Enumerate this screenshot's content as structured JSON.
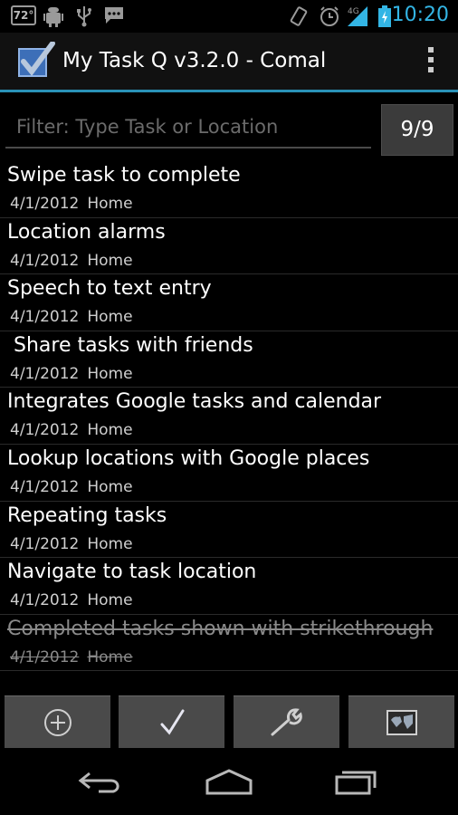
{
  "status_bar": {
    "temperature": "72°",
    "time": "10:20",
    "network": "4G",
    "icons": [
      "weather-icon",
      "android-icon",
      "usb-icon",
      "chat-icon",
      "vibrate-icon",
      "alarm-icon",
      "signal-icon",
      "battery-charging-icon"
    ]
  },
  "action_bar": {
    "title": "My Task Q v3.2.0 - Comal",
    "app_icon": "checkbox-check-icon",
    "overflow_icon": "overflow-menu-icon"
  },
  "filter": {
    "placeholder": "Filter: Type Task or Location",
    "value": "",
    "count": "9/9"
  },
  "tasks": [
    {
      "title": "Swipe task to complete",
      "date": "4/1/2012",
      "location": "Home",
      "completed": false
    },
    {
      "title": "Location alarms",
      "date": "4/1/2012",
      "location": "Home",
      "completed": false
    },
    {
      "title": "Speech to text entry",
      "date": "4/1/2012",
      "location": "Home",
      "completed": false
    },
    {
      "title": " Share tasks with friends",
      "date": "4/1/2012",
      "location": "Home",
      "completed": false
    },
    {
      "title": "Integrates Google tasks and calendar",
      "date": "4/1/2012",
      "location": "Home",
      "completed": false
    },
    {
      "title": "Lookup locations with Google places",
      "date": "4/1/2012",
      "location": "Home",
      "completed": false
    },
    {
      "title": "Repeating tasks",
      "date": "4/1/2012",
      "location": "Home",
      "completed": false
    },
    {
      "title": "Navigate to task location",
      "date": "4/1/2012",
      "location": "Home",
      "completed": false
    },
    {
      "title": "Completed tasks shown with strikethrough",
      "date": "4/1/2012",
      "location": "Home",
      "completed": true
    }
  ],
  "toolbar": {
    "buttons": [
      "add-circle-icon",
      "checkmark-icon",
      "wrench-icon",
      "map-icon"
    ]
  },
  "navigation": {
    "buttons": [
      "back-icon",
      "home-icon",
      "recents-icon"
    ]
  },
  "colors": {
    "accent": "#33b5e5",
    "background": "#000000",
    "toolbar_button": "#4a4a4a",
    "completed_text": "#8a8a8a"
  }
}
